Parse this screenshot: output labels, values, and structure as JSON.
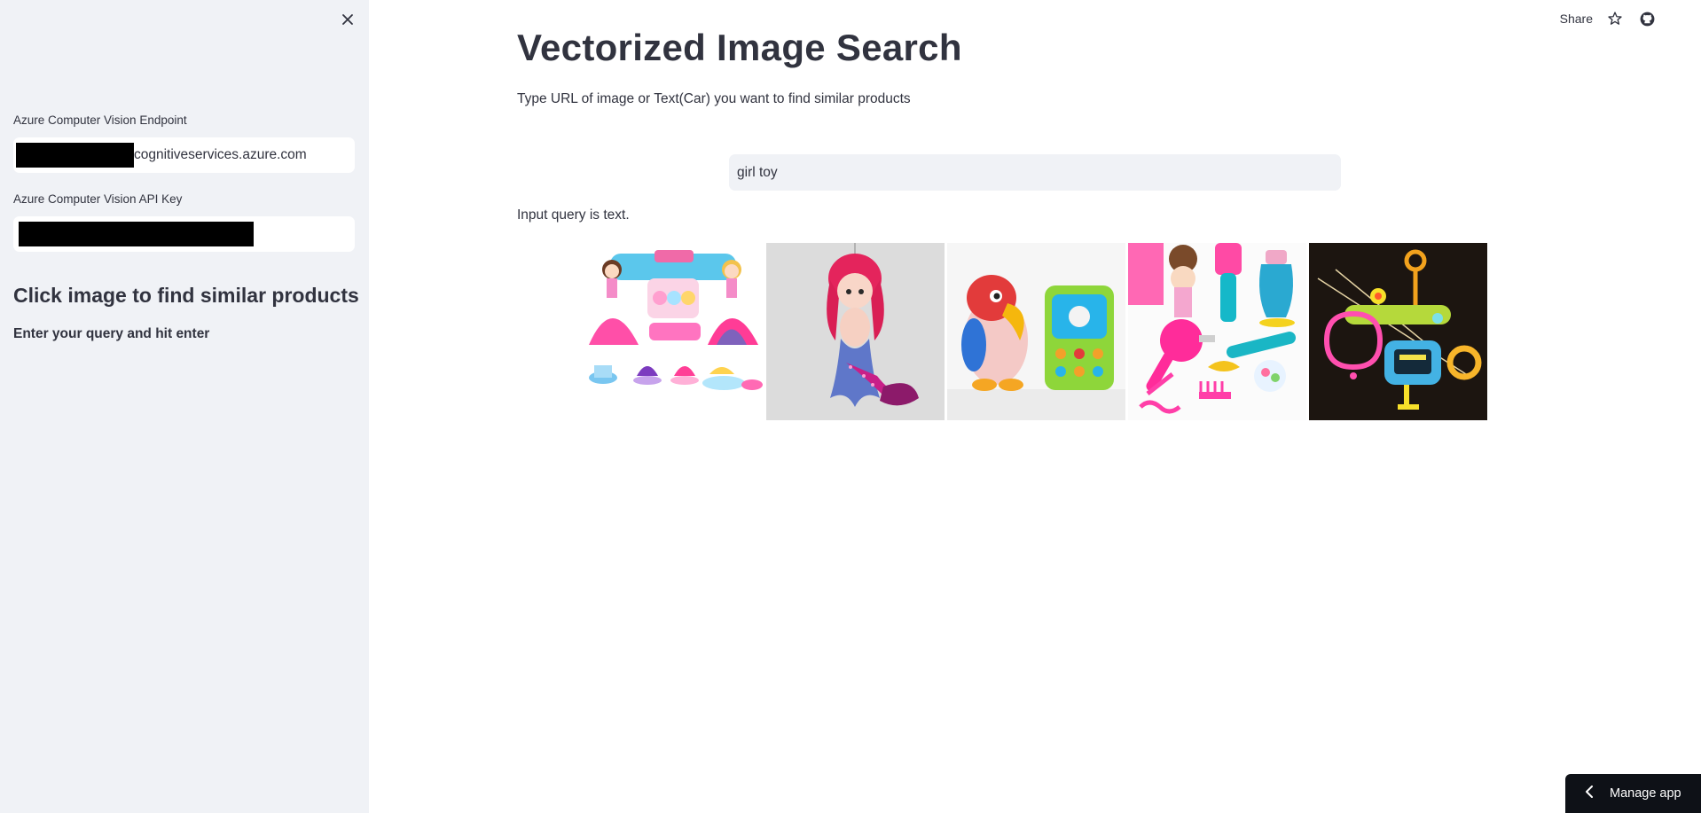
{
  "sidebar": {
    "endpoint_label": "Azure Computer Vision Endpoint",
    "endpoint_value": "cognitiveservices.azure.com",
    "api_key_label": "Azure Computer Vision API Key",
    "heading": "Click image to find similar products",
    "subheading": "Enter your query and hit enter"
  },
  "header": {
    "share_label": "Share",
    "icons": [
      "star-icon",
      "github-icon"
    ]
  },
  "main": {
    "title": "Vectorized Image Search",
    "description": "Type URL of image or Text(Car) you want to find similar products",
    "query_value": "girl toy",
    "status_text": "Input query is text.",
    "results": [
      "princess-dolls-tea-set",
      "mermaid-plush",
      "parrot-toy-phone",
      "hair-styling-toys",
      "colorful-toy-gadget"
    ]
  },
  "footer": {
    "manage_label": "Manage app"
  }
}
